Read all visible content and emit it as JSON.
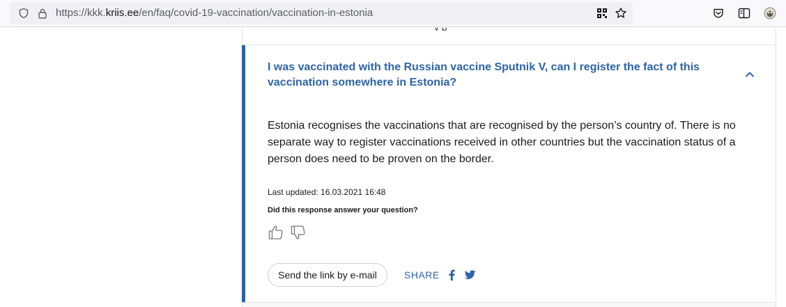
{
  "browser": {
    "url_prefix": "https://kkk.",
    "url_domain": "kriis.ee",
    "url_path": "/en/faq/covid-19-vaccination/vaccination-in-estonia",
    "icons": [
      "shield-icon",
      "lock-icon",
      "qr-code-icon",
      "bookmark-star-icon",
      "pocket-icon",
      "reader-view-icon",
      "extension-icon"
    ]
  },
  "faq": {
    "title": "I was vaccinated with the Russian vaccine Sputnik V, can I register the fact of this vaccination somewhere in Estonia?",
    "answer": "Estonia recognises the vaccinations that are recognised by the person’s country of. There is no separate way to register vaccinations received in other countries but the vaccination status of a person does need to be proven on the border.",
    "last_updated": "Last updated: 16.03.2021 16:48",
    "feedback_question": "Did this response answer your question?",
    "send_link_label": "Send the link by e-mail",
    "share_label": "SHARE"
  },
  "colors": {
    "accent": "#2b63ad",
    "link": "#2c64a8",
    "text": "#1a1a1a"
  }
}
